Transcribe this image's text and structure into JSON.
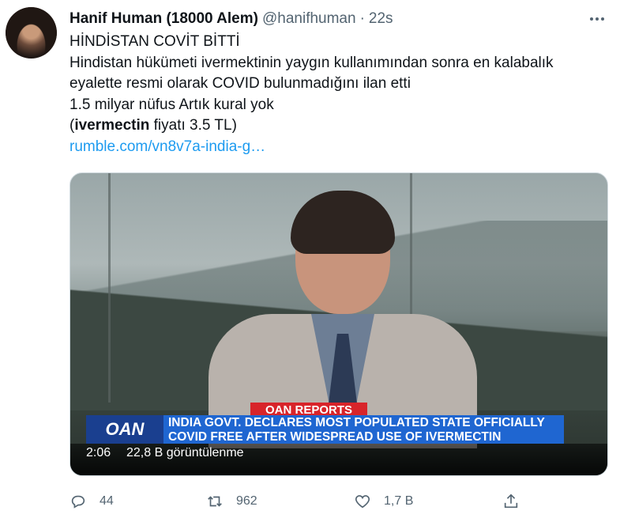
{
  "tweet": {
    "display_name": "Hanif Human (18000 Alem)",
    "handle": "@hanifhuman",
    "separator": "·",
    "time": "22s",
    "more_icon": "more-icon",
    "lines": [
      "HİNDİSTAN COVİT BİTTİ",
      "Hindistan hükümeti ivermektinin yaygın kullanımından sonra en kalabalık",
      "eyalette resmi olarak COVID bulunmadığını ilan etti",
      "1.5 milyar nüfus Artık kural yok"
    ],
    "price_open": "(",
    "price_bold": "ivermectin",
    "price_rest": " fiyatı 3.5 TL)",
    "link": "rumble.com/vn8v7a-india-g…"
  },
  "media": {
    "banner_top": "OAN REPORTS",
    "logo": "OAN",
    "headline_line1": "INDIA GOVT. DECLARES MOST POPULATED STATE OFFICIALLY",
    "headline_line2": "COVID FREE AFTER WIDESPREAD USE OF IVERMECTIN",
    "duration": "2:06",
    "views": "22,8 B görüntülenme"
  },
  "actions": {
    "reply_count": "44",
    "retweet_count": "962",
    "like_count": "1,7 B",
    "reply_icon": "reply-icon",
    "retweet_icon": "retweet-icon",
    "like_icon": "heart-icon",
    "share_icon": "share-icon"
  }
}
